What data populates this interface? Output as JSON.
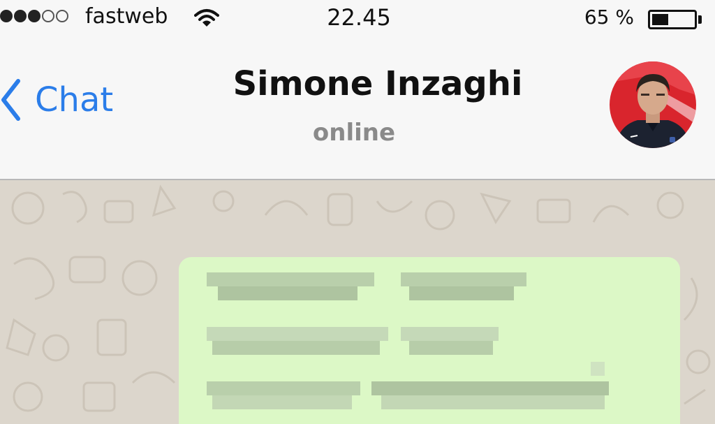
{
  "status_bar": {
    "signal_bars_filled": 3,
    "signal_bars_total": 5,
    "carrier": "fastweb",
    "time": "22.45",
    "battery_percent_label": "65 %",
    "battery_level": 0.4
  },
  "header": {
    "back_label": "Chat",
    "contact_name": "Simone Inzaghi",
    "contact_status": "online"
  },
  "colors": {
    "accent": "#2b7de9",
    "bubble": "#dcf8c6",
    "chat_background": "#dcd6cc"
  },
  "message": {
    "content_state": "pixelated"
  }
}
